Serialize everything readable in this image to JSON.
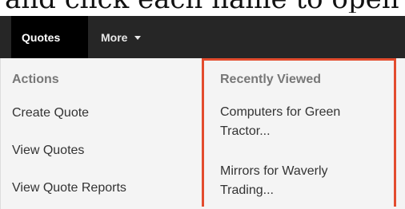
{
  "doc_text": "and click each name to open th",
  "nav": {
    "tabs": [
      {
        "label": "Quotes"
      },
      {
        "label": "More"
      }
    ]
  },
  "menu": {
    "actions": {
      "heading": "Actions",
      "items": [
        "Create Quote",
        "View Quotes",
        "View Quote Reports"
      ]
    },
    "recently_viewed": {
      "heading": "Recently Viewed",
      "items": [
        {
          "line1": "Computers for Green",
          "line2": "Tractor..."
        },
        {
          "line1": "Mirrors for Waverly",
          "line2": "Trading..."
        }
      ]
    }
  },
  "colors": {
    "navbar": "#262626",
    "active_tab": "#000000",
    "highlight": "#e34c2e",
    "panel": "#f4f4f4"
  }
}
